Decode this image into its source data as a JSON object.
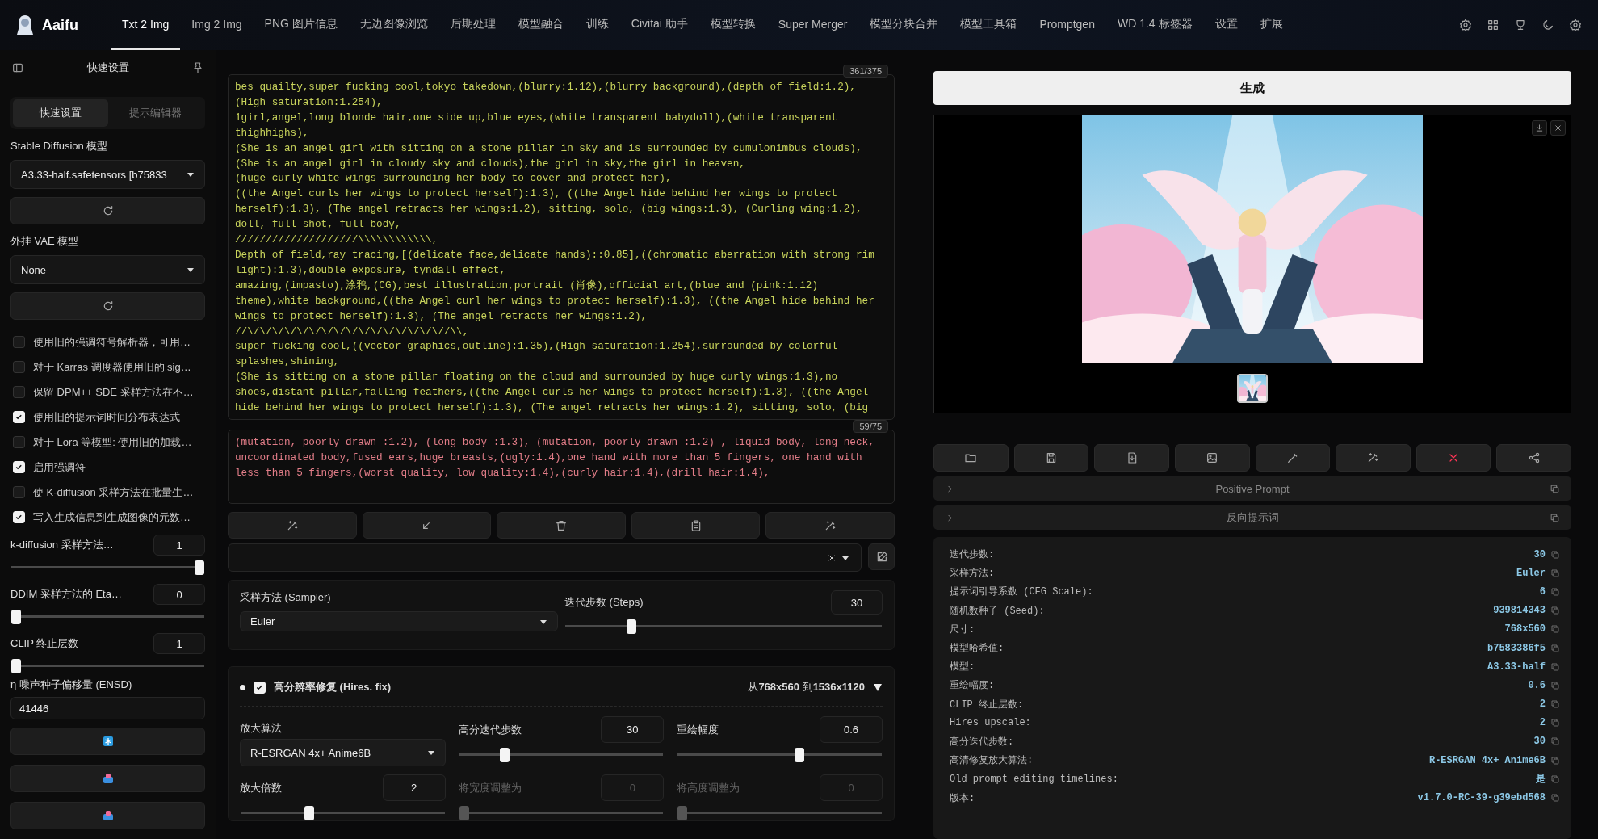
{
  "app": {
    "title": "Aaifu"
  },
  "nav_tabs": [
    {
      "label": "Txt 2 Img",
      "selected": true
    },
    {
      "label": "Img 2 Img",
      "selected": false
    },
    {
      "label": "PNG 图片信息",
      "selected": false
    },
    {
      "label": "无边图像浏览",
      "selected": false
    },
    {
      "label": "后期处理",
      "selected": false
    },
    {
      "label": "模型融合",
      "selected": false
    },
    {
      "label": "训练",
      "selected": false
    },
    {
      "label": "Civitai 助手",
      "selected": false
    },
    {
      "label": "模型转换",
      "selected": false
    },
    {
      "label": "Super Merger",
      "selected": false
    },
    {
      "label": "模型分块合并",
      "selected": false
    },
    {
      "label": "模型工具箱",
      "selected": false
    },
    {
      "label": "Promptgen",
      "selected": false
    },
    {
      "label": "WD 1.4 标签器",
      "selected": false
    },
    {
      "label": "设置",
      "selected": false
    },
    {
      "label": "扩展",
      "selected": false
    }
  ],
  "sidebar": {
    "title": "快速设置",
    "tabs": [
      {
        "label": "快速设置",
        "selected": true
      },
      {
        "label": "提示编辑器",
        "selected": false
      }
    ],
    "controls": [
      {
        "kind": "select",
        "label": "Stable Diffusion 模型",
        "value": "A3.33-half.safetensors [b75833"
      },
      {
        "kind": "refresh"
      },
      {
        "kind": "select",
        "label": "外挂 VAE 模型",
        "value": "None"
      },
      {
        "kind": "refresh"
      },
      {
        "kind": "checkbox",
        "label": "使用旧的强调符号解析器，可用…",
        "checked": false
      },
      {
        "kind": "checkbox",
        "label": "对于 Karras 调度器使用旧的 sig…",
        "checked": false
      },
      {
        "kind": "checkbox",
        "label": "保留 DPM++ SDE 采样方法在不…",
        "checked": false
      },
      {
        "kind": "checkbox",
        "label": "使用旧的提示词时间分布表达式",
        "checked": true
      },
      {
        "kind": "checkbox",
        "label": "对于 Lora 等模型: 使用旧的加载…",
        "checked": false
      },
      {
        "kind": "checkbox",
        "label": "启用强调符",
        "checked": true
      },
      {
        "kind": "checkbox",
        "label": "使 K-diffusion 采样方法在批量生…",
        "checked": false
      },
      {
        "kind": "checkbox",
        "label": "写入生成信息到生成图像的元数…",
        "checked": true
      },
      {
        "kind": "slider",
        "label": "k-diffusion 采样方法…",
        "value": "1",
        "level": 1
      },
      {
        "kind": "slider",
        "label": "DDIM 采样方法的 Eta…",
        "value": "0",
        "level": 0
      },
      {
        "kind": "slider",
        "label": "CLIP 终止层数",
        "value": "1",
        "level": 0
      },
      {
        "kind": "text",
        "label": "η 噪声种子偏移量 (ENSD)",
        "value": "41446"
      },
      {
        "kind": "star-button"
      },
      {
        "kind": "tray-button"
      },
      {
        "kind": "tray-button"
      }
    ]
  },
  "prompt": {
    "counter": "361/375",
    "text": "bes quailty,super fucking cool,tokyo takedown,(blurry:1.12),(blurry background),(depth of field:1.2),\n(High saturation:1.254),\n1girl,angel,long blonde hair,one side up,blue eyes,(white transparent babydoll),(white transparent\nthighhighs),\n(She is an angel girl with sitting on a stone pillar in sky and is surrounded by cumulonimbus clouds),\n(She is an angel girl in cloudy sky and clouds),the girl in sky,the girl in heaven,\n(huge curly white wings surrounding her body to cover and protect her),\n((the Angel curls her wings to protect herself):1.3), ((the Angel hide behind her wings to protect\nherself):1.3), (The angel retracts her wings:1.2), sitting, solo, (big wings:1.3), (Curling wing:1.2),\ndoll, full shot, full body,\n////////////////////\\\\\\\\\\\\\\\\\\\\\\\\,\nDepth of field,ray tracing,[(delicate face,delicate hands)::0.85],((chromatic aberration with strong rim\nlight):1.3),double exposure, tyndall effect,\namazing,(impasto),涂鸦,(CG),best illustration,portrait (肖像),official art,(blue and (pink:1.12)\ntheme),white background,((the Angel curl her wings to protect herself):1.3), ((the Angel hide behind her\nwings to protect herself):1.3), (The angel retracts her wings:1.2),\n//\\/\\/\\/\\/\\/\\/\\/\\/\\/\\/\\/\\/\\/\\/\\/\\//\\\\,\nsuper fucking cool,((vector graphics,outline):1.35),(High saturation:1.254),surrounded by colorful\nsplashes,shining,\n(She is sitting on a stone pillar floating on the cloud and surrounded by huge curly wings:1.3),no\nshoes,distant pillar,falling feathers,((the Angel curls her wings to protect herself):1.3), ((the Angel\nhide behind her wings to protect herself):1.3), (The angel retracts her wings:1.2), sitting, solo, (big"
  },
  "negative_prompt": {
    "counter": "59/75",
    "text": "(mutation, poorly drawn :1.2), (long body :1.3), (mutation, poorly drawn :1.2) , liquid body, long neck,\nuncoordinated body,fused ears,huge breasts,(ugly:1.4),one hand with more than 5 fingers, one hand with\nless than 5 fingers,(worst quality, low quality:1.4),(curly hair:1.4),(drill hair:1.4),"
  },
  "sampler": {
    "label": "采样方法 (Sampler)",
    "value": "Euler"
  },
  "steps": {
    "label": "迭代步数 (Steps)",
    "value": "30",
    "level": 0.2
  },
  "hires": {
    "enabled": true,
    "title": "高分辨率修复 (Hires. fix)",
    "summary": "从**768x560** 到**1536x1120**",
    "fields": [
      {
        "kind": "select",
        "label": "放大算法",
        "value": "R-ESRGAN 4x+ Anime6B"
      },
      {
        "kind": "slider",
        "label": "高分迭代步数",
        "value": "30",
        "level": 0.21,
        "disabled": false
      },
      {
        "kind": "slider",
        "label": "重绘幅度",
        "value": "0.6",
        "level": 0.6,
        "disabled": false
      },
      {
        "kind": "slider",
        "label": "放大倍数",
        "value": "2",
        "level": 0.33,
        "disabled": false
      },
      {
        "kind": "slider",
        "label": "将宽度调整为",
        "value": "0",
        "level": 0,
        "disabled": true
      },
      {
        "kind": "slider",
        "label": "将高度调整为",
        "value": "0",
        "level": 0,
        "disabled": true
      }
    ]
  },
  "generate_button": "生成",
  "accordions": [
    {
      "label": "Positive Prompt",
      "expanded": false
    },
    {
      "label": "反向提示词",
      "expanded": false
    }
  ],
  "info": [
    {
      "label": "迭代步数:",
      "value": "30"
    },
    {
      "label": "采样方法:",
      "value": "Euler"
    },
    {
      "label": "提示词引导系数 (CFG Scale):",
      "value": "6"
    },
    {
      "label": "随机数种子 (Seed):",
      "value": "939814343"
    },
    {
      "label": "尺寸:",
      "value": "768x560"
    },
    {
      "label": "模型哈希值:",
      "value": "b7583386f5"
    },
    {
      "label": "模型:",
      "value": "A3.33-half"
    },
    {
      "label": "重绘幅度:",
      "value": "0.6"
    },
    {
      "label": "CLIP 终止层数:",
      "value": "2"
    },
    {
      "label": "Hires upscale:",
      "value": "2"
    },
    {
      "label": "高分迭代步数:",
      "value": "30"
    },
    {
      "label": "高清修复放大算法:",
      "value": "R-ESRGAN 4x+ Anime6B"
    },
    {
      "label": "Old prompt editing timelines:",
      "value": "是"
    },
    {
      "label": "版本:",
      "value": "v1.7.0-RC-39-g39ebd568"
    }
  ]
}
